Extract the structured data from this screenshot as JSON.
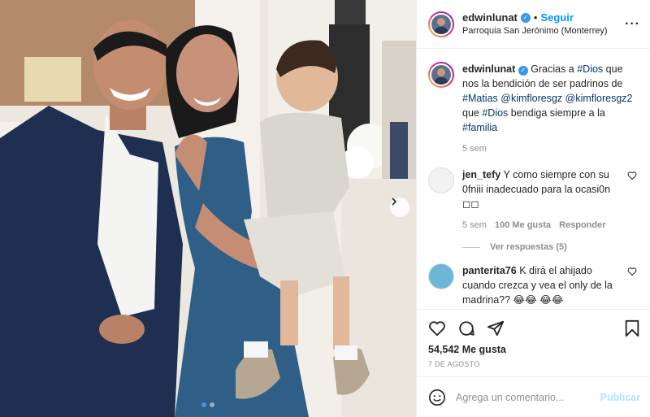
{
  "header": {
    "username": "edwinlunat",
    "separator": "•",
    "follow_label": "Seguir",
    "location": "Parroquia San Jerónimo (Monterrey)",
    "more_label": "···"
  },
  "caption": {
    "username": "edwinlunat",
    "text_1": "Gracias a ",
    "tag_dios": "#Dios",
    "text_2": " que nos la bendición de ser padrinos de ",
    "tag_matias": "#Matias",
    "mention_1": "@kimfloresgz",
    "mention_2": "@kimfloresgz2",
    "text_3": " que ",
    "tag_dios_2": "#Dios",
    "text_4": " bendiga siempre a la ",
    "tag_familia": "#familia",
    "time": "5 sem"
  },
  "comments": [
    {
      "username": "jen_tefy",
      "text": "Y como siempre con su 0fniii inadecuado para la ocasi0n ◻◻",
      "time": "5 sem",
      "likes": "100 Me gusta",
      "reply": "Responder",
      "view_replies": "Ver respuestas (5)"
    },
    {
      "username": "panterita76",
      "text": "K dirá el ahijado cuando crezca y vea el only de la madrina?? 😂😂 😂😂"
    }
  ],
  "stats": {
    "likes": "54,542 Me gusta",
    "date": "7 DE AGOSTO"
  },
  "composer": {
    "placeholder": "Agrega un comentario...",
    "post_label": "Publicar"
  },
  "icons": {
    "verified": "verified-badge-icon",
    "heart": "heart-icon",
    "comment": "comment-icon",
    "share": "share-icon",
    "save": "bookmark-icon",
    "emoji": "emoji-icon",
    "next": "chevron-right-icon"
  },
  "colors": {
    "link": "#00376b",
    "follow": "#0095f6",
    "verified": "#3897f0",
    "muted": "#8e8e8e",
    "post_disabled": "#b2dffc"
  },
  "carousel": {
    "total": 2,
    "active": 1
  }
}
